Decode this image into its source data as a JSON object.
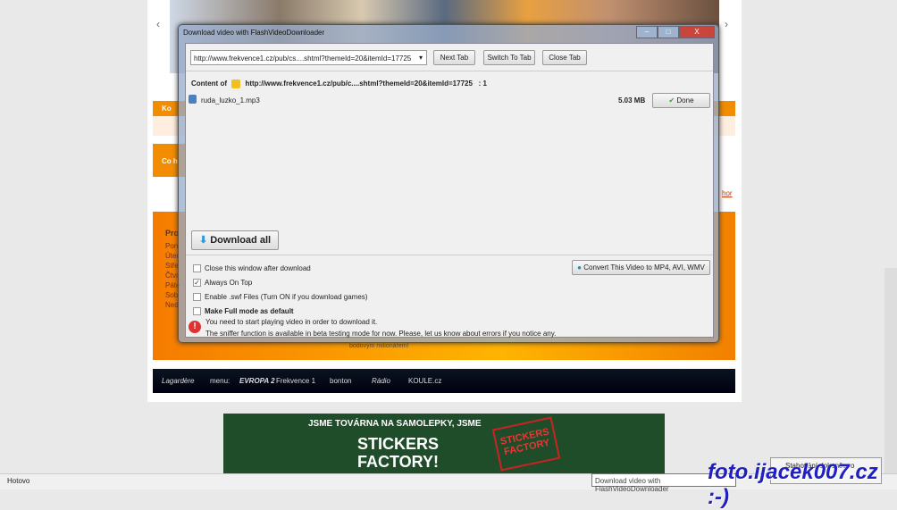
{
  "dialog": {
    "title": "Download video with FlashVideoDownloader",
    "url_select": "http://www.frekvence1.cz/pub/cs....shtml?themeId=20&itemId=17725",
    "next_tab": "Next Tab",
    "switch_tab": "Switch To Tab",
    "close_tab": "Close Tab",
    "content_of": "Content of",
    "content_url": "http://www.frekvence1.cz/pub/c....shtml?themeId=20&itemId=17725",
    "content_count": ": 1",
    "file": {
      "name": "ruda_luzko_1.mp3",
      "size": "5.03 MB",
      "action": "Done"
    },
    "download_all": "Download all",
    "convert": "Convert This Video to MP4, AVI, WMV",
    "options": [
      {
        "label": "Close this window after download",
        "checked": false
      },
      {
        "label": "Always On Top",
        "checked": true
      },
      {
        "label": "Enable .swf Files (Turn ON if you download games)",
        "checked": false
      },
      {
        "label": "Make Full mode as default",
        "checked": false
      }
    ],
    "warning1": "You need to start playing video in order to download it.",
    "warning2": "The sniffer function is available in beta testing mode for now. Please, let us know about errors if you notice any."
  },
  "page": {
    "orange_label1": "Ko",
    "orange_label2": "Co h",
    "program_title": "Pro",
    "days": [
      "Pon",
      "Úter",
      "Stře",
      "Čtvr",
      "Pátе",
      "Sob",
      "Ned"
    ],
    "link_right": "hor",
    "caption": "bodovým milionářem!",
    "footer": [
      "Lagardère",
      "menu:",
      "EVROPA 2",
      "Frekvence 1",
      "bonton",
      "Rádio",
      "KOULE.cz"
    ],
    "ad_line1": "JSME TOVÁRNA NA SAMOLEPKY, JSME",
    "ad_line2": "STICKERS",
    "ad_line3": "FACTORY!",
    "ad_badge": "STICKERS FACTORY"
  },
  "statusbar": {
    "text": "Hotovo",
    "tooltip": "Download video with FlashVideoDownloader",
    "notify": "Stahování dokončeno"
  },
  "watermark": "foto.ijacek007.cz :-)"
}
